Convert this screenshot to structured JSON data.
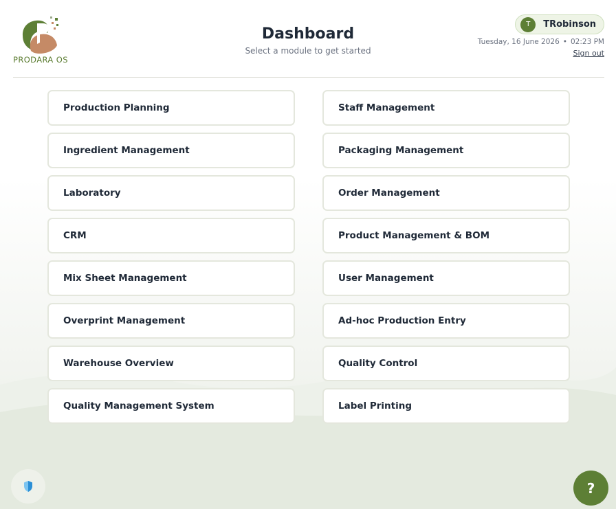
{
  "brand": {
    "name": "PRODARA OS",
    "colors": {
      "green": "#5d7f35",
      "terracotta": "#c58a66",
      "light_green": "#eef4e6"
    }
  },
  "header": {
    "title": "Dashboard",
    "subtitle": "Select a module to get started"
  },
  "user": {
    "initial": "T",
    "name": "TRobinson",
    "date": "Tuesday, 16 June 2026",
    "separator": "•",
    "time": "02:23 PM",
    "signout_label": "Sign out"
  },
  "modules": [
    {
      "label": "Production Planning"
    },
    {
      "label": "Staff Management"
    },
    {
      "label": "Ingredient Management"
    },
    {
      "label": "Packaging Management"
    },
    {
      "label": "Laboratory"
    },
    {
      "label": "Order Management"
    },
    {
      "label": "CRM"
    },
    {
      "label": "Product Management & BOM"
    },
    {
      "label": "Mix Sheet Management"
    },
    {
      "label": "User Management"
    },
    {
      "label": "Overprint Management"
    },
    {
      "label": "Ad-hoc Production Entry"
    },
    {
      "label": "Warehouse Overview"
    },
    {
      "label": "Quality Control"
    },
    {
      "label": "Quality Management System"
    },
    {
      "label": "Label Printing"
    }
  ],
  "floating": {
    "shield_icon": "shield-icon",
    "help_label": "?"
  }
}
